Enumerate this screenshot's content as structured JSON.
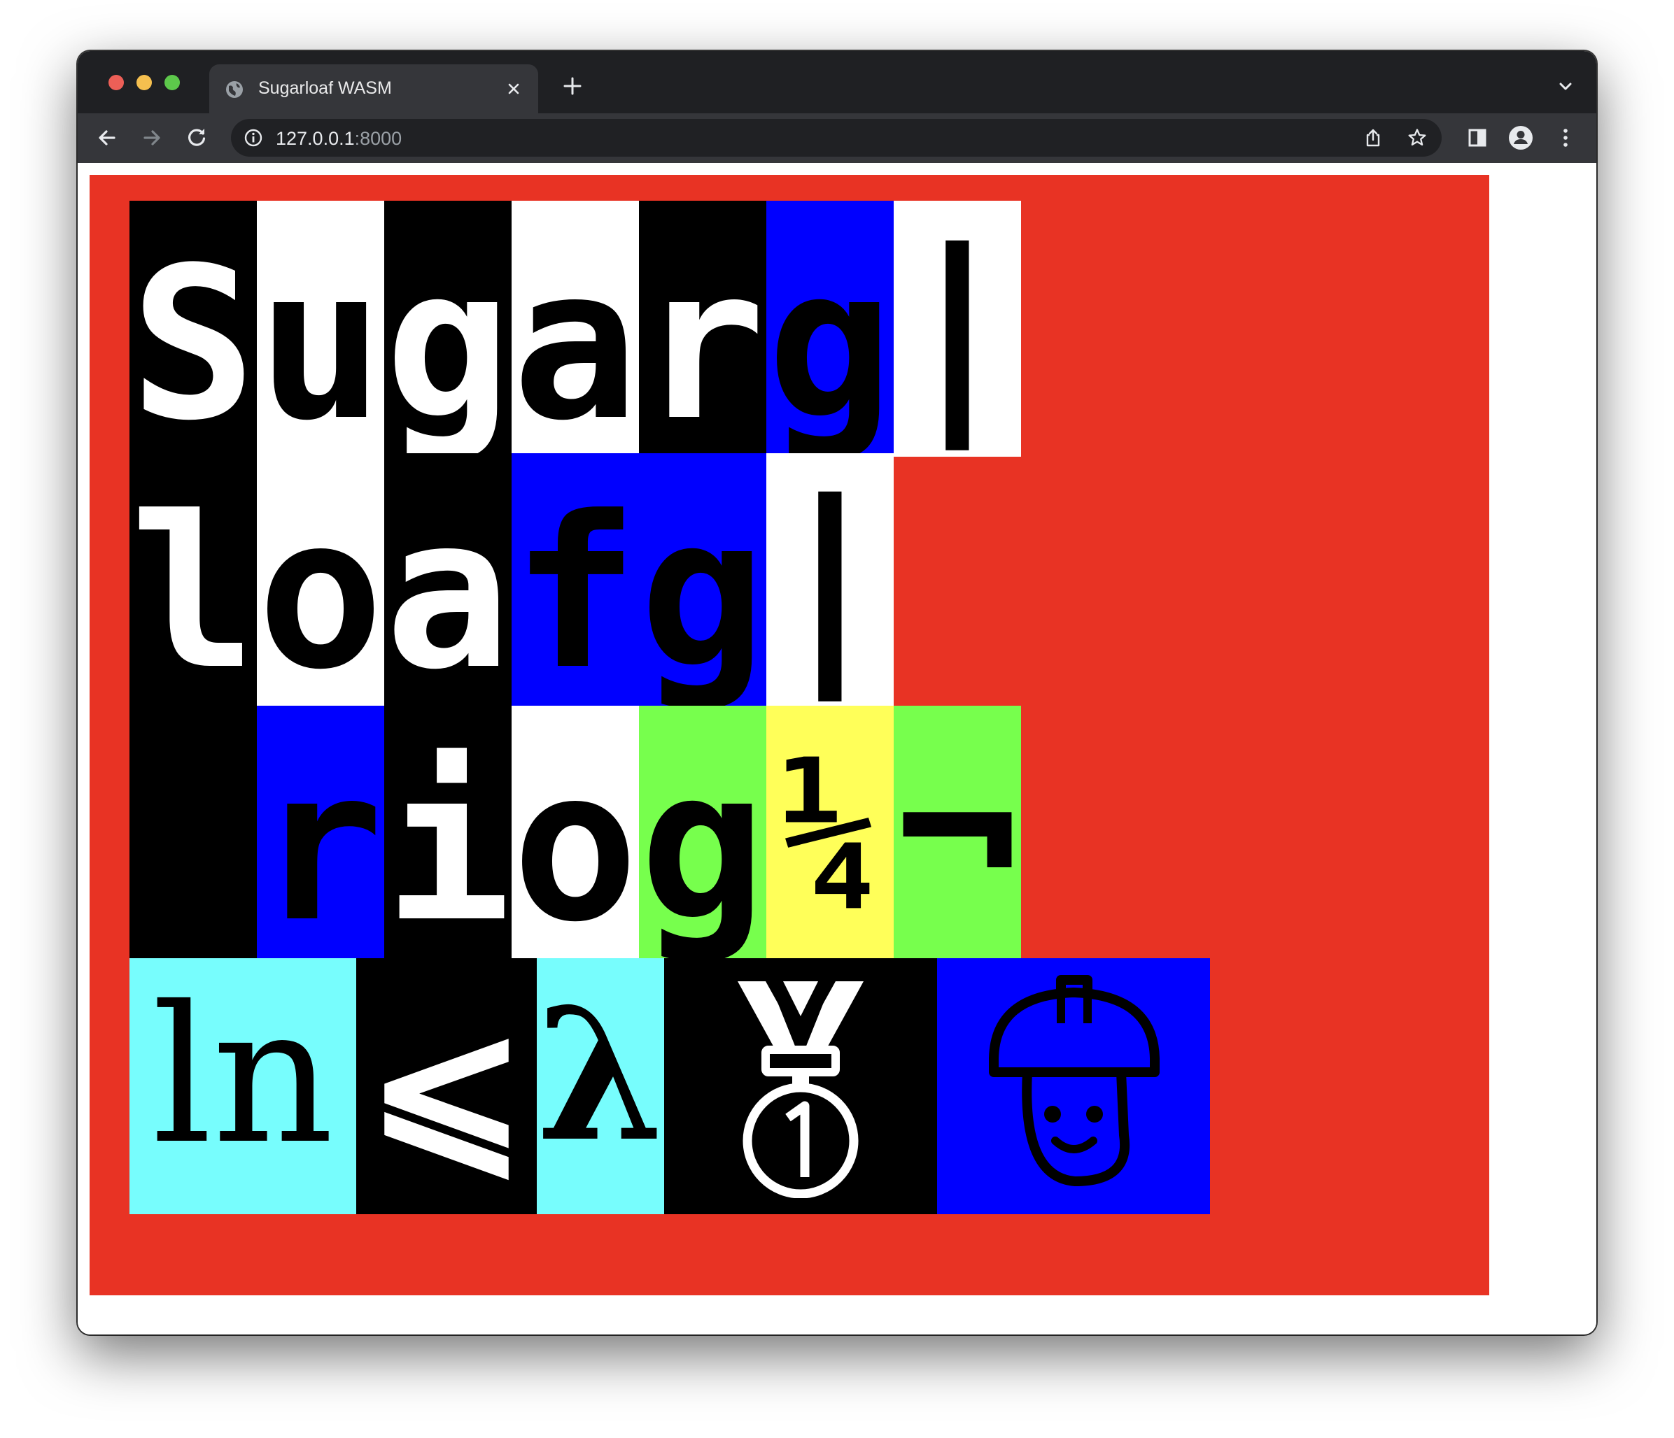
{
  "browser": {
    "tab": {
      "title": "Sugarloaf WASM",
      "favicon": "globe-icon"
    },
    "url": {
      "host": "127.0.0.1",
      "port": ":8000"
    },
    "icons": {
      "back": "arrow-left-icon",
      "forward": "arrow-right-icon",
      "reload": "reload-icon",
      "share": "share-icon",
      "bookmark": "star-icon",
      "side_panel": "side-panel-icon",
      "profile": "profile-icon",
      "menu": "kebab-menu-icon",
      "new_tab": "plus-icon",
      "tab_search": "chevron-down-icon"
    }
  },
  "sugarloaf": {
    "background": "#e83324",
    "rows": [
      {
        "cells": [
          {
            "text": "S",
            "bg": "#000000",
            "fg": "#ffffff"
          },
          {
            "text": "u",
            "bg": "#ffffff",
            "fg": "#000000"
          },
          {
            "text": "g",
            "bg": "#000000",
            "fg": "#ffffff"
          },
          {
            "text": "a",
            "bg": "#ffffff",
            "fg": "#000000"
          },
          {
            "text": "r",
            "bg": "#000000",
            "fg": "#ffffff"
          },
          {
            "text": "g",
            "bg": "#0000ff",
            "fg": "#000000"
          },
          {
            "text": "|",
            "bg": "#ffffff",
            "fg": "#000000"
          }
        ]
      },
      {
        "cells": [
          {
            "text": "l",
            "bg": "#000000",
            "fg": "#ffffff"
          },
          {
            "text": "o",
            "bg": "#ffffff",
            "fg": "#000000"
          },
          {
            "text": "a",
            "bg": "#000000",
            "fg": "#ffffff"
          },
          {
            "text": "f",
            "bg": "#0000ff",
            "fg": "#000000"
          },
          {
            "text": "g",
            "bg": "#0000ff",
            "fg": "#000000"
          },
          {
            "text": "|",
            "bg": "#ffffff",
            "fg": "#000000"
          }
        ]
      },
      {
        "cells": [
          {
            "text": " ",
            "bg": "#000000",
            "fg": "#ffffff"
          },
          {
            "text": "r",
            "bg": "#0000ff",
            "fg": "#000000"
          },
          {
            "text": "i",
            "bg": "#000000",
            "fg": "#ffffff"
          },
          {
            "text": "o",
            "bg": "#ffffff",
            "fg": "#000000"
          },
          {
            "text": "g",
            "bg": "#77ff4d",
            "fg": "#000000"
          },
          {
            "text": "¼",
            "bg": "#ffff59",
            "fg": "#000000"
          },
          {
            "text": "¬",
            "bg": "#77ff4d",
            "fg": "#000000"
          }
        ]
      },
      {
        "cells": [
          {
            "text": "ln",
            "bg": "#77fdfd",
            "fg": "#000000"
          },
          {
            "text": "⩽",
            "bg": "#000000",
            "fg": "#ffffff"
          },
          {
            "text": "λ",
            "bg": "#77fdfd",
            "fg": "#000000"
          },
          {
            "text": "🥇",
            "bg": "#000000",
            "fg": "#ffffff",
            "icon": "first-place-medal-icon"
          },
          {
            "text": "👷",
            "bg": "#0000ff",
            "fg": "#000000",
            "icon": "construction-worker-icon"
          }
        ]
      }
    ]
  }
}
